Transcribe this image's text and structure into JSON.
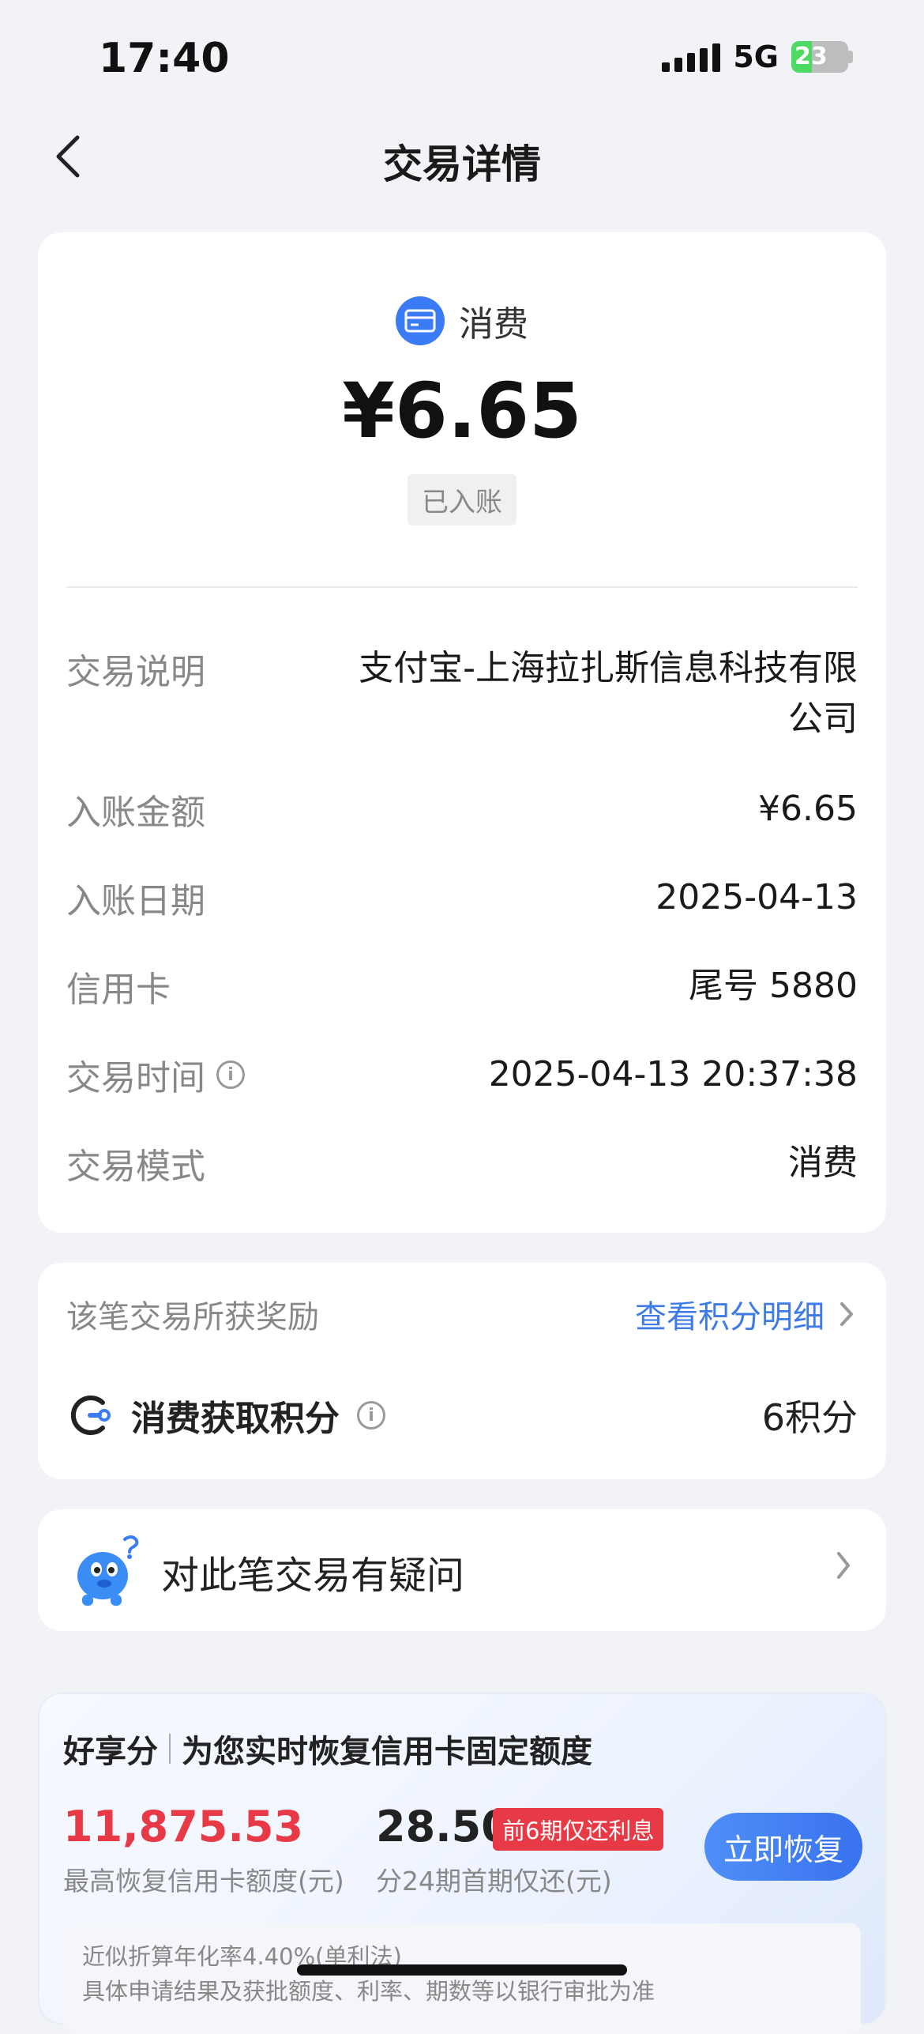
{
  "status_bar": {
    "time": "17:40",
    "network": "5G",
    "battery": "23"
  },
  "nav": {
    "title": "交易详情"
  },
  "summary": {
    "type_label": "消费",
    "amount": "¥6.65",
    "status": "已入账"
  },
  "details": [
    {
      "label": "交易说明",
      "value": "支付宝-上海拉扎斯信息科技有限\n公司"
    },
    {
      "label": "入账金额",
      "value": "¥6.65"
    },
    {
      "label": "入账日期",
      "value": "2025-04-13"
    },
    {
      "label": "信用卡",
      "value": "尾号 5880"
    },
    {
      "label": "交易时间",
      "value": "2025-04-13 20:37:38"
    },
    {
      "label": "交易模式",
      "value": "消费"
    }
  ],
  "rewards": {
    "title": "该笔交易所获奖励",
    "link": "查看积分明细",
    "item_label": "消费获取积分",
    "item_value": "6积分"
  },
  "dispute": {
    "label": "对此笔交易有疑问"
  },
  "promo": {
    "brand": "好享分",
    "headline": "为您实时恢复信用卡固定额度",
    "limit_value": "11,875.53",
    "limit_caption": "最高恢复信用卡额度(元)",
    "installment_value": "28.50",
    "installment_tag": "前6期仅还利息",
    "installment_caption": "分24期首期仅还(元)",
    "button": "立即恢复",
    "note_line1": "近似折算年化率4.40%(单利法)",
    "note_line2": "具体申请结果及获批额度、利率、期数等以银行审批为准"
  },
  "colors": {
    "accent_blue": "#3f7be8",
    "alert_red": "#e83a46",
    "background": "#f2f3f7"
  }
}
